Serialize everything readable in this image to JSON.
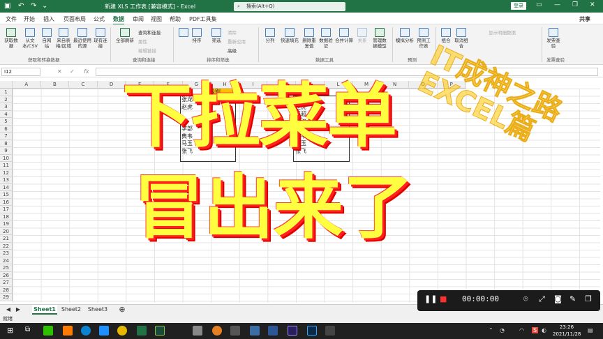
{
  "titlebar": {
    "title": "新建 XLS 工作表 [兼容模式] - Excel",
    "search_placeholder": "搜索(Alt+Q)",
    "login": "登录",
    "accent": "#217346"
  },
  "menu": [
    "文件",
    "开始",
    "插入",
    "页面布局",
    "公式",
    "数据",
    "审阅",
    "视图",
    "帮助",
    "PDF工具集"
  ],
  "share": "共享",
  "ribbon": {
    "get_data": [
      "获取数据",
      "从文本/CSV",
      "自网站",
      "来自表格/区域",
      "最近使用的源",
      "现有连接"
    ],
    "group1": "获取和转换数据",
    "refresh": "全部刷新",
    "query_small": [
      "查询和连接",
      "属性",
      "编辑链接"
    ],
    "group2": "查询和连接",
    "sort": "排序",
    "filter": "筛选",
    "filter_small": [
      "清除",
      "重新应用",
      "高级"
    ],
    "group3": "排序和筛选",
    "tools": [
      "分列",
      "快速填充",
      "删除重复值",
      "数据验证",
      "合并计算",
      "关系",
      "管理数据模型"
    ],
    "group4": "数据工具",
    "forecast": [
      "模拟分析",
      "预测工作表"
    ],
    "group5": "预测",
    "outline": [
      "组合",
      "取消组合"
    ],
    "outline_small": "显示明细数据",
    "invoice": "发票查验",
    "group6": "发票查验"
  },
  "formula": {
    "namebox": "I12",
    "fx": "fx"
  },
  "columns": [
    "A",
    "B",
    "C",
    "D",
    "E",
    "F",
    "G",
    "H",
    "I",
    "J",
    "K",
    "L",
    "M",
    "N",
    "O",
    "P"
  ],
  "rows": [
    "1",
    "2",
    "3",
    "4",
    "5",
    "6",
    "7",
    "8",
    "9",
    "10",
    "11",
    "12",
    "13",
    "14",
    "15",
    "16",
    "17",
    "18",
    "19",
    "20",
    "21",
    "22",
    "23",
    "24",
    "25",
    "26",
    "27",
    "28",
    "29"
  ],
  "cells": {
    "g_header": "级别",
    "g": [
      "张龙",
      "赵虎",
      "",
      "",
      "李部",
      "典韦",
      "马玉",
      "张飞"
    ],
    "h2": "部门",
    "k_header": "姓名",
    "k": [
      "张龙",
      "赵虎",
      "王超",
      "马汉",
      "李部",
      "典韦",
      "马玉",
      "张飞"
    ]
  },
  "sheets": [
    "Sheet1",
    "Sheet2",
    "Sheet3"
  ],
  "status": "就绪",
  "overlay": {
    "line1": "下拉菜单",
    "line2": "冒出来了"
  },
  "watermark": {
    "line1": "IT成神之路",
    "line2": "EXCEL篇"
  },
  "recorder": {
    "time": "00:00:00"
  },
  "clock": {
    "time": "23:26",
    "date": "2021/11/28"
  }
}
